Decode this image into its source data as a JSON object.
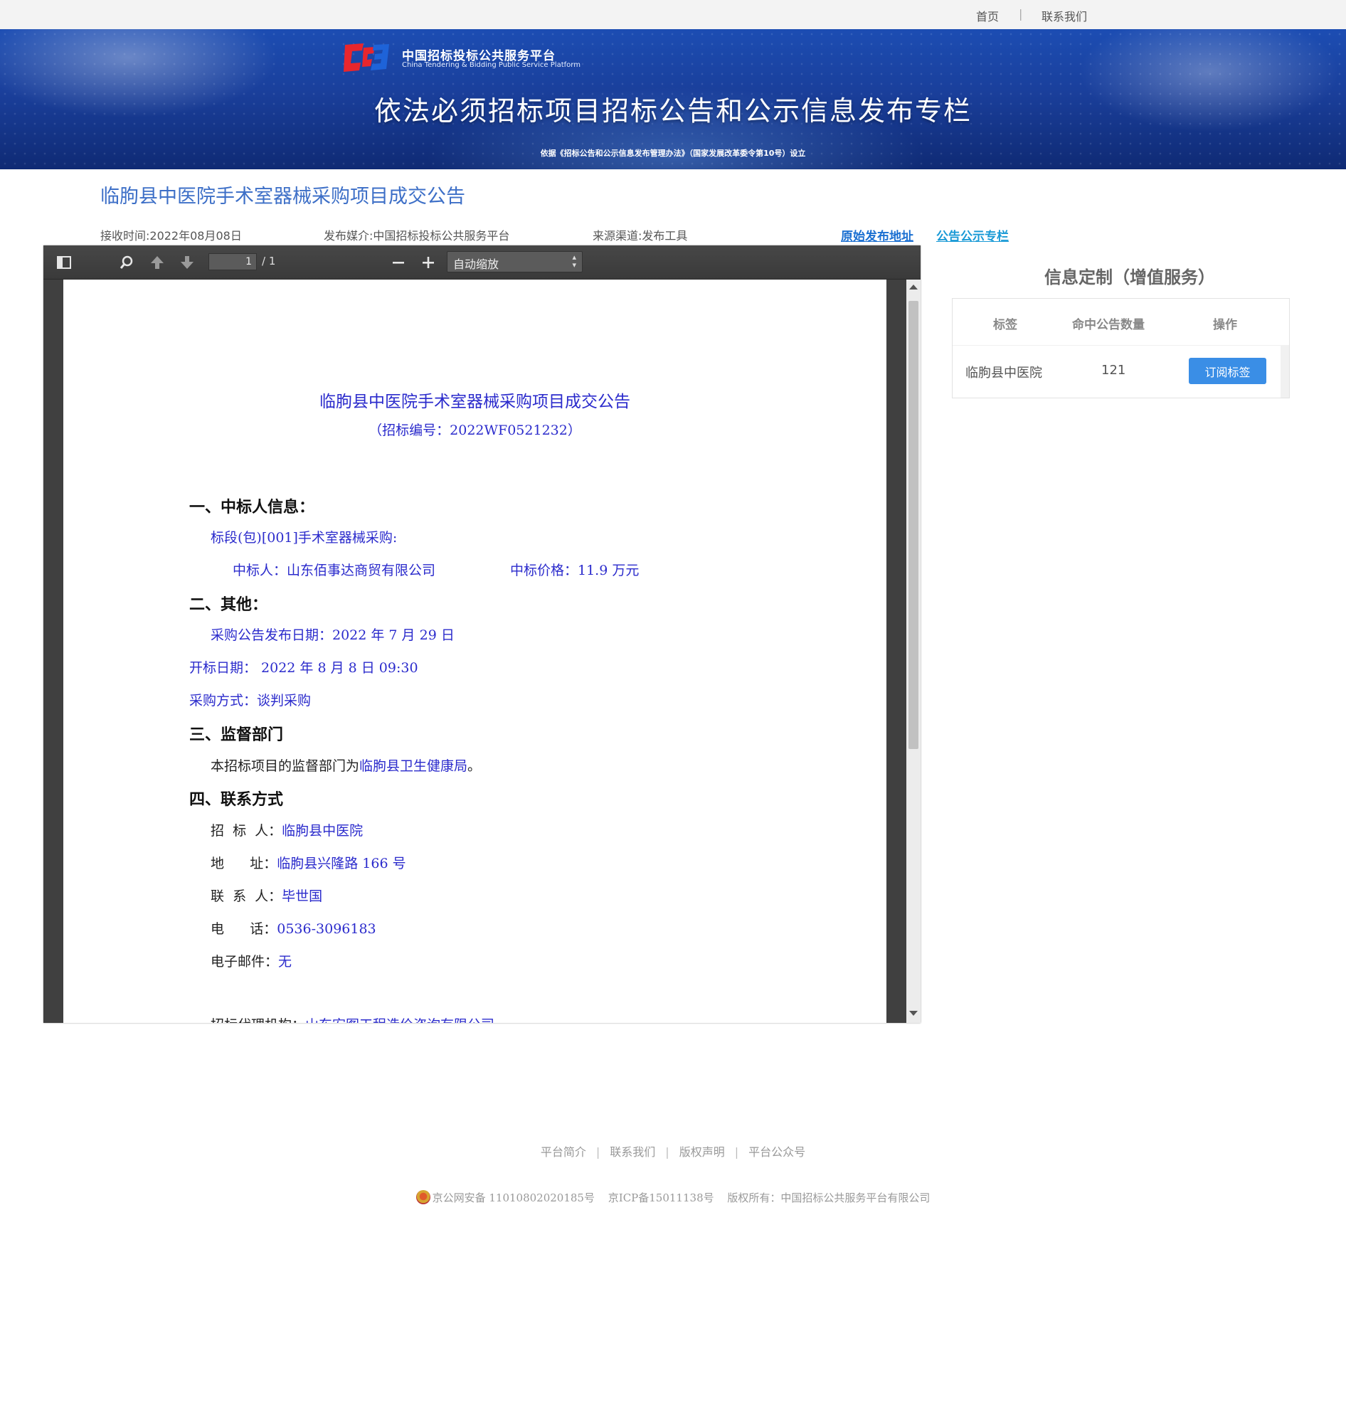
{
  "topnav": {
    "home": "首页",
    "separator": "|",
    "contact": "联系我们"
  },
  "banner": {
    "logo_cn": "中国招标投标公共服务平台",
    "logo_en": "China Tendering & Bidding Public Service Platform",
    "main_title": "依法必须招标项目招标公告和公示信息发布专栏",
    "sub_title": "依据《招标公告和公示信息发布管理办法》（国家发展改革委令第10号）设立"
  },
  "notice": {
    "title": "临朐县中医院手术室器械采购项目成交公告",
    "received": "接收时间:2022年08月08日",
    "media": "发布媒介:中国招标投标公共服务平台",
    "channel": "来源渠道:发布工具",
    "original_link": "原始发布地址",
    "column_link": "公告公示专栏"
  },
  "viewer": {
    "page_current": "1",
    "page_total": "/ 1",
    "zoom": "自动缩放",
    "icons": [
      "sidebar-toggle-icon",
      "search-icon",
      "arrow-up-icon",
      "arrow-down-icon",
      "zoom-out-icon",
      "zoom-in-icon"
    ]
  },
  "document": {
    "title": "临朐县中医院手术室器械采购项目成交公告",
    "bid_no": "（招标编号：2022WF0521232）",
    "s1": "一、中标人信息：",
    "lot": "标段(包)[001]手术室器械采购:",
    "winner": "中标人：山东佰事达商贸有限公司",
    "price": "中标价格：11.9 万元",
    "s2": "二、其他：",
    "publish_date": "采购公告发布日期：2022 年 7 月 29 日",
    "open_date": "开标日期：  2022 年 8 月 8 日 09:30",
    "method": "采购方式：谈判采购",
    "s3": "三、监督部门",
    "supervise_prefix": "本招标项目的监督部门为",
    "supervise_dept": "临朐县卫生健康局",
    "supervise_suffix": "。",
    "s4": "四、联系方式",
    "c_tenderer_label": "招  标  人：",
    "c_tenderer": "临朐县中医院",
    "c_address_label": "地      址：",
    "c_address": "临朐县兴隆路 166 号",
    "c_person_label": "联  系  人：",
    "c_person": "毕世国",
    "c_phone_label": "电      话：",
    "c_phone": "0536-3096183",
    "c_email_label": "电子邮件：",
    "c_email": "无",
    "agency_partial_label": "招标代理机构：",
    "agency_partial": "山东宏图工程造价咨询有限公司"
  },
  "side": {
    "title": "信息定制（增值服务）",
    "headers": [
      "标签",
      "命中公告数量",
      "操作"
    ],
    "row": {
      "tag": "临朐县中医院",
      "count": "121",
      "action": "订阅标签"
    }
  },
  "footer": {
    "links": [
      "平台简介",
      "联系我们",
      "版权声明",
      "平台公众号"
    ],
    "separator": "|",
    "police": "京公网安备 11010802020185号",
    "icp": "京ICP备15011138号",
    "copyright": "版权所有：中国招标公共服务平台有限公司"
  },
  "colors": {
    "accent": "#3d6fc7",
    "link": "#1a6fd1",
    "button": "#3a8ee6",
    "doc_blue": "#2b2bcc"
  }
}
